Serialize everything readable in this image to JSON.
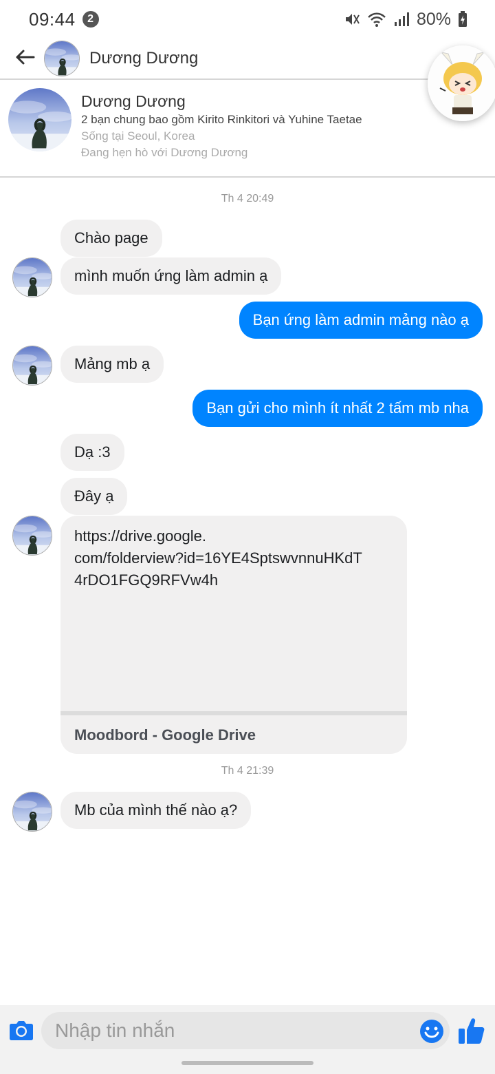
{
  "status_bar": {
    "time": "09:44",
    "notification_count": "2",
    "battery": "80%"
  },
  "header": {
    "contact_name": "Dương Dương"
  },
  "profile": {
    "name": "Dương Dương",
    "mutual_friends": "2 bạn chung bao gồm Kirito Rinkitori và Yuhine Taetae",
    "location": "Sống tại Seoul, Korea",
    "relationship": "Đang hẹn hò với Dương Dương"
  },
  "conversation": {
    "timestamp_1": "Th 4 20:49",
    "messages": [
      {
        "from": "them",
        "text": "Chào page"
      },
      {
        "from": "them",
        "text": "mình muốn ứng làm admin ạ"
      },
      {
        "from": "me",
        "text": "Bạn ứng làm admin mảng nào ạ"
      },
      {
        "from": "them",
        "text": "Mảng mb ạ"
      },
      {
        "from": "me",
        "text": "Bạn gửi cho mình ít nhất 2 tấm mb nha"
      },
      {
        "from": "them",
        "text": "Dạ :3"
      },
      {
        "from": "them",
        "text": "Đây ạ"
      }
    ],
    "link_card": {
      "url": "https://drive.google.com/folderview?id=16YE4SptswvnnuHKdT4rDO1FGQ9RFVw4h",
      "url_line_1": "https://drive.google.",
      "url_line_2": "com/folderview?id=16YE4SptswvnnuHKdT",
      "url_line_3": "4rDO1FGQ9RFVw4h",
      "title": "Moodbord - Google Drive"
    },
    "timestamp_2": "Th 4 21:39",
    "last_message": {
      "from": "them",
      "text": "Mb của mình thế nào ạ?"
    }
  },
  "composer": {
    "placeholder": "Nhập tin nhắn"
  },
  "icons": {
    "back": "arrow-left-icon",
    "camera": "camera-icon",
    "emoji": "smiley-icon",
    "like": "thumbs-up-icon"
  },
  "colors": {
    "outgoing_bubble": "#0084ff",
    "incoming_bubble": "#f1f0f0",
    "accent": "#0084ff"
  }
}
